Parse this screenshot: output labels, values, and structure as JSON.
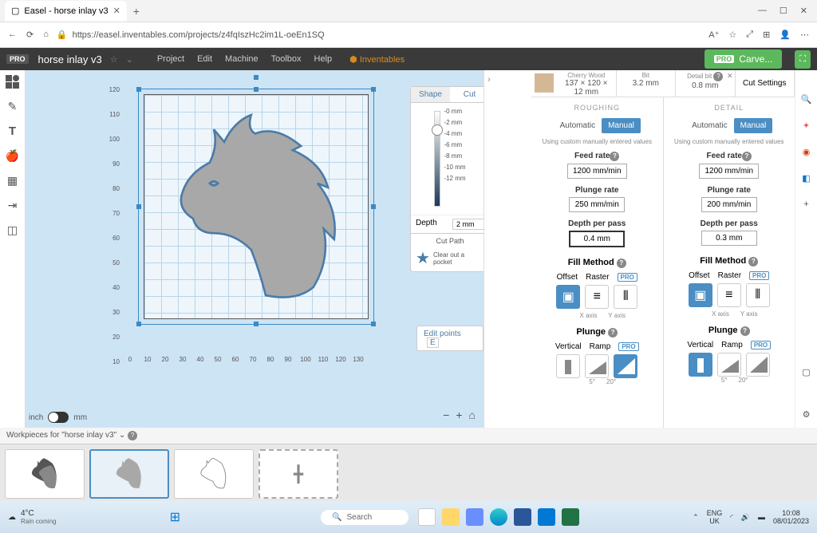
{
  "browser": {
    "tab_title": "Easel - horse inlay v3",
    "url": "https://easel.inventables.com/projects/z4fqIszHc2im1L-oeEn1SQ"
  },
  "header": {
    "badge": "PRO",
    "project_name": "horse inlay v3",
    "menu": [
      "Project",
      "Edit",
      "Machine",
      "Toolbox",
      "Help"
    ],
    "brand": "Inventables",
    "carve_label": "Carve..."
  },
  "canvas": {
    "ruler_y": [
      "120",
      "110",
      "100",
      "90",
      "80",
      "70",
      "60",
      "50",
      "40",
      "30",
      "20",
      "10"
    ],
    "ruler_x": [
      "0",
      "10",
      "20",
      "30",
      "40",
      "50",
      "60",
      "70",
      "80",
      "90",
      "100",
      "110",
      "120",
      "130"
    ],
    "unit_left": "inch",
    "unit_right": "mm",
    "edit_points": "Edit points",
    "edit_points_key": "E"
  },
  "cut_panel": {
    "tab_shape": "Shape",
    "tab_cut": "Cut",
    "depth_marks": [
      "-0 mm",
      "-2 mm",
      "-4 mm",
      "-6 mm",
      "-8 mm",
      "-10 mm",
      "-12 mm"
    ],
    "depth_label": "Depth",
    "depth_value": "2 mm",
    "cut_path_label": "Cut Path",
    "cut_path_desc": "Clear out a pocket"
  },
  "material": {
    "wood_label": "Cherry Wood",
    "wood_dims": "137 × 120 × 12 mm",
    "bit_label": "Bit",
    "bit_value": "3.2 mm",
    "detail_label": "Detail bit",
    "detail_value": "0.8 mm",
    "cut_settings": "Cut Settings"
  },
  "settings": {
    "roughing_title": "ROUGHING",
    "detail_title": "DETAIL",
    "auto_label": "Automatic",
    "manual_label": "Manual",
    "help_text": "Using custom manually entered values",
    "feed_rate_label": "Feed rate",
    "roughing": {
      "feed_rate": "1200 mm/min",
      "plunge_rate": "250 mm/min",
      "depth_per_pass": "0.4 mm"
    },
    "detail": {
      "feed_rate": "1200 mm/min",
      "plunge_rate": "200 mm/min",
      "depth_per_pass": "0.3 mm"
    },
    "plunge_rate_label": "Plunge rate",
    "depth_per_pass_label": "Depth per pass",
    "fill_method_label": "Fill Method",
    "offset_label": "Offset",
    "raster_label": "Raster",
    "xaxis_label": "X axis",
    "yaxis_label": "Y axis",
    "plunge_label": "Plunge",
    "vertical_label": "Vertical",
    "ramp_label": "Ramp",
    "angle_5": "5°",
    "angle_20": "20°"
  },
  "workpieces": {
    "title": "Workpieces for \"horse inlay v3\""
  },
  "taskbar": {
    "temp": "4°C",
    "weather_desc": "Rain coming",
    "search": "Search",
    "lang1": "ENG",
    "lang2": "UK",
    "time": "10:08",
    "date": "08/01/2023"
  }
}
